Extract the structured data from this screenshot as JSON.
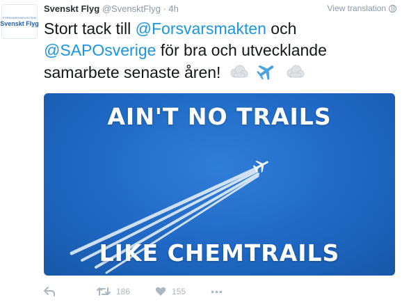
{
  "avatar": {
    "tagline": "FÖRSVARSINDUSTRIN",
    "logo_text": "Svenskt Flyg"
  },
  "tweet": {
    "display_name": "Svenskt Flyg",
    "handle": "@SvensktFlyg",
    "separator": "·",
    "time": "4h",
    "view_translation": "View translation",
    "text_part1": "Stort tack till ",
    "mention1": "@Forsvarsmakten",
    "text_part2": " och ",
    "mention2": "@SAPOsverige",
    "text_part3": " för bra och utvecklande samarbete senaste åren!",
    "emojis": [
      "cloud-emoji",
      "airplane-emoji",
      "cloud-emoji"
    ]
  },
  "media": {
    "top_text": "AIN'T NO TRAILS",
    "bottom_text": "LIKE CHEMTRAILS",
    "sky_color": "#1f68c4"
  },
  "actions": {
    "retweet_count": "186",
    "like_count": "155",
    "more_label": "•••"
  },
  "colors": {
    "link": "#1b95e0",
    "muted": "#8899a6",
    "action": "#aab8c2"
  }
}
